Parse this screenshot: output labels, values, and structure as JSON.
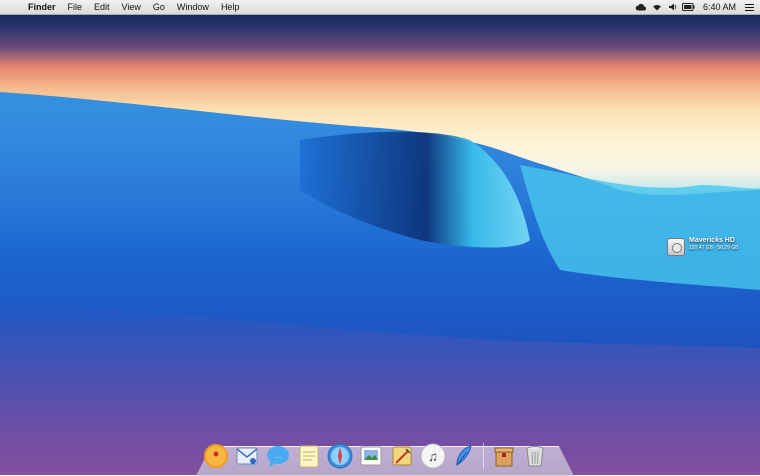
{
  "menubar": {
    "apple_glyph": "",
    "app_name": "Finder",
    "menus": [
      "File",
      "Edit",
      "View",
      "Go",
      "Window",
      "Help"
    ],
    "status_icons": [
      "cloud-icon",
      "wifi-icon",
      "volume-icon",
      "battery-icon"
    ],
    "clock": "6:40 AM"
  },
  "desktop": {
    "drive": {
      "name": "Mavericks HD",
      "size": "120.47 GB · 56.29 GB"
    }
  },
  "dock": {
    "items": [
      "launchpad-icon",
      "mail-icon",
      "messages-icon",
      "notes-icon",
      "safari-icon",
      "preview-icon",
      "notes2-icon",
      "itunes-icon",
      "feather-icon",
      "archive-icon",
      "trash-icon"
    ]
  }
}
